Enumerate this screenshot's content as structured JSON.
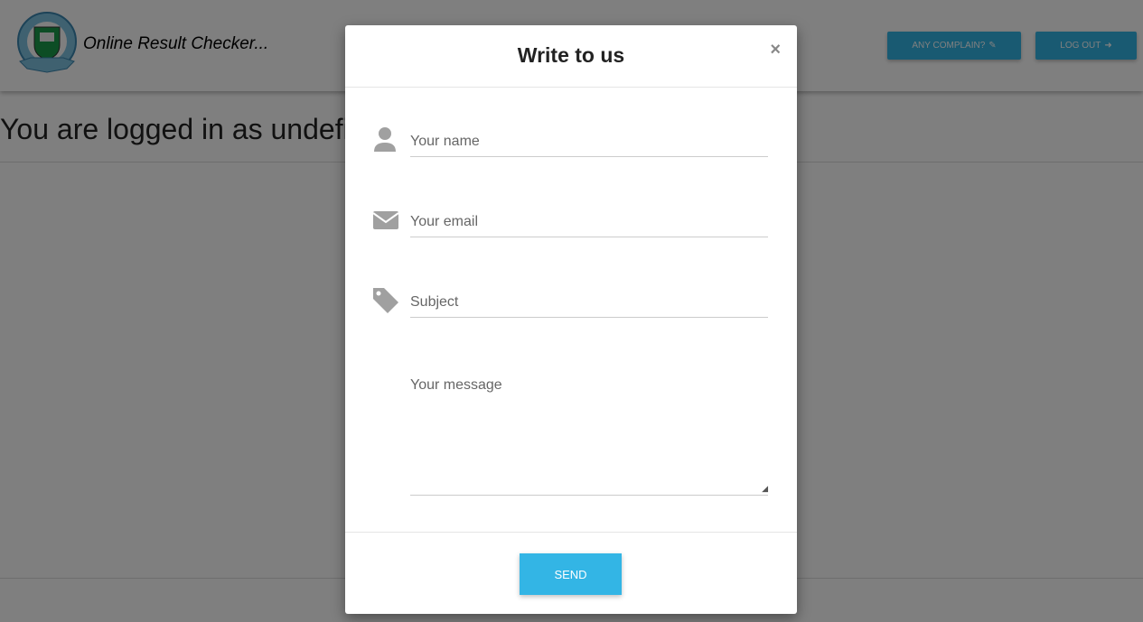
{
  "header": {
    "title": "Online Result Checker...",
    "complain_label": "Any complain?",
    "logout_label": "Log out"
  },
  "status_text": "You are logged in as undefined",
  "modal": {
    "title": "Write to us",
    "close": "×",
    "fields": {
      "name": "Your name",
      "email": "Your email",
      "subject": "Subject",
      "message": "Your message"
    },
    "send_label": "Send"
  },
  "colors": {
    "accent": "#33b5e5"
  }
}
